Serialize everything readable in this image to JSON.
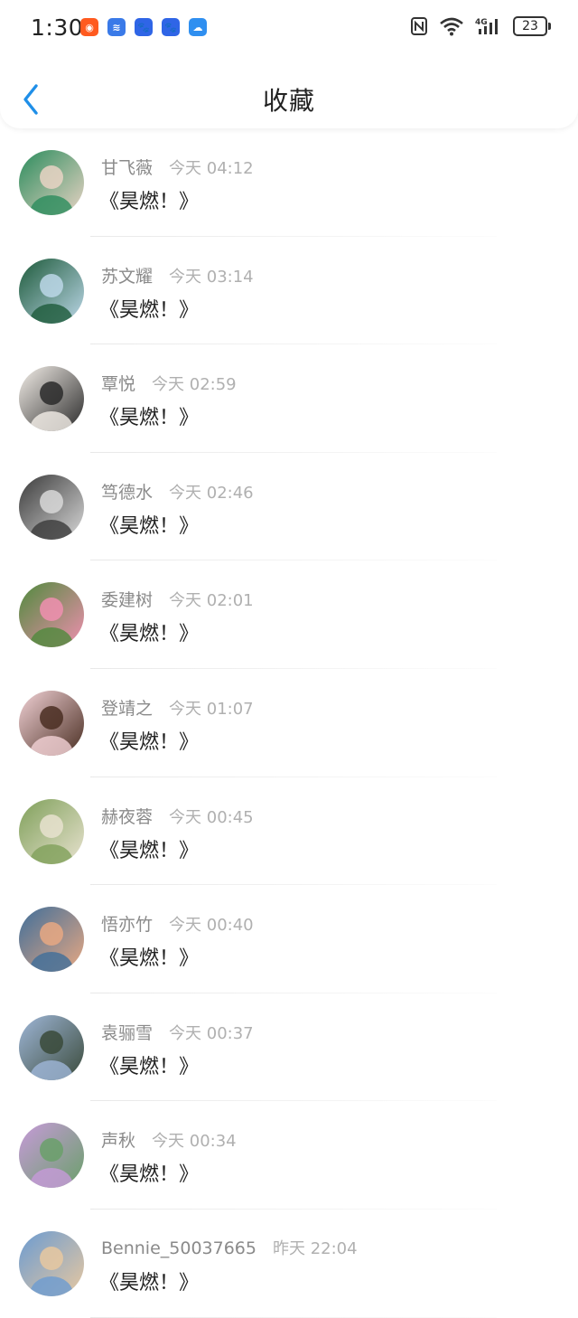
{
  "status_bar": {
    "time": "1:30",
    "battery": "23",
    "app_icons": [
      {
        "name": "kuaishou-icon",
        "color": "#ff5a1f",
        "glyph": "◉"
      },
      {
        "name": "voice-app-icon",
        "color": "#3a7ae8",
        "glyph": "≋"
      },
      {
        "name": "baidu-icon-1",
        "color": "#2f65e6",
        "glyph": "🐾"
      },
      {
        "name": "baidu-icon-2",
        "color": "#2f65e6",
        "glyph": "🐾"
      },
      {
        "name": "cloud-icon",
        "color": "#2f8ff0",
        "glyph": "☁"
      }
    ]
  },
  "header": {
    "title": "收藏"
  },
  "favorites": [
    {
      "user": "甘飞薇",
      "time": "今天 04:12",
      "book": "《昊燃！》",
      "avatar_colors": [
        "#2a8c5c",
        "#e9d3c4"
      ]
    },
    {
      "user": "苏文耀",
      "time": "今天 03:14",
      "book": "《昊燃！》",
      "avatar_colors": [
        "#1d5a3a",
        "#bcd7e8"
      ]
    },
    {
      "user": "覃悦",
      "time": "今天 02:59",
      "book": "《昊燃！》",
      "avatar_colors": [
        "#f4efe9",
        "#2a2a2a"
      ]
    },
    {
      "user": "笃德水",
      "time": "今天 02:46",
      "book": "《昊燃！》",
      "avatar_colors": [
        "#3a3a3a",
        "#d8d8d8"
      ]
    },
    {
      "user": "委建树",
      "time": "今天 02:01",
      "book": "《昊燃！》",
      "avatar_colors": [
        "#4f8a3c",
        "#f08fb0"
      ]
    },
    {
      "user": "登靖之",
      "time": "今天 01:07",
      "book": "《昊燃！》",
      "avatar_colors": [
        "#f2d2d6",
        "#4a2e22"
      ]
    },
    {
      "user": "赫夜蓉",
      "time": "今天 00:45",
      "book": "《昊燃！》",
      "avatar_colors": [
        "#7fa05a",
        "#e8e2cf"
      ]
    },
    {
      "user": "悟亦竹",
      "time": "今天 00:40",
      "book": "《昊燃！》",
      "avatar_colors": [
        "#3f6e9a",
        "#e8a882"
      ]
    },
    {
      "user": "袁骊雪",
      "time": "今天 00:37",
      "book": "《昊燃！》",
      "avatar_colors": [
        "#9fb7d8",
        "#3a4a3a"
      ]
    },
    {
      "user": "声秋",
      "time": "今天 00:34",
      "book": "《昊燃！》",
      "avatar_colors": [
        "#c79ad9",
        "#6aa06a"
      ]
    },
    {
      "user": "Bennie_50037665",
      "time": "昨天 22:04",
      "book": "《昊燃！》",
      "avatar_colors": [
        "#6b9bd1",
        "#e8c8a0"
      ]
    }
  ],
  "colors": {
    "accent": "#1f8fe8"
  }
}
